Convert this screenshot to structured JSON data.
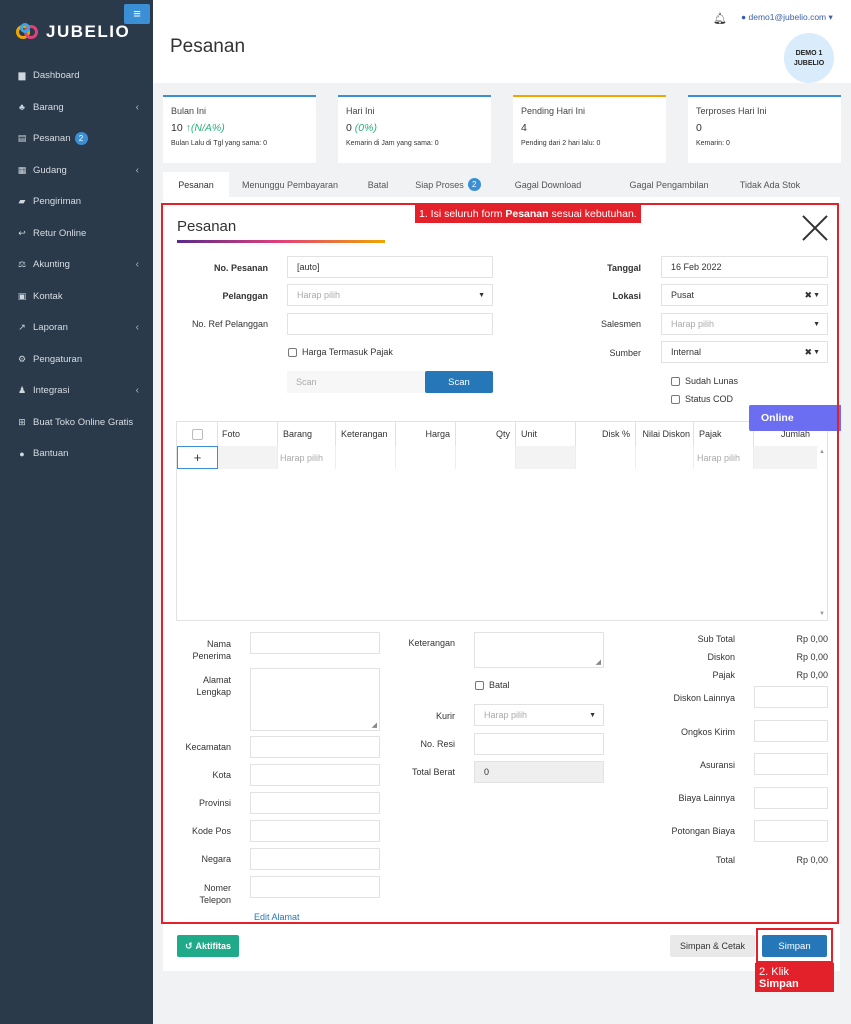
{
  "app": {
    "brand": "JUBELIO",
    "menu_toggle": "≡"
  },
  "sidebar": {
    "items": [
      {
        "label": "Dashboard",
        "icon": "▆",
        "chev": ""
      },
      {
        "label": "Barang",
        "icon": "♣",
        "chev": "‹"
      },
      {
        "label": "Pesanan",
        "icon": "▤",
        "chev": "",
        "badge": "2"
      },
      {
        "label": "Gudang",
        "icon": "▦",
        "chev": "‹"
      },
      {
        "label": "Pengiriman",
        "icon": "▰",
        "chev": ""
      },
      {
        "label": "Retur Online",
        "icon": "↩",
        "chev": ""
      },
      {
        "label": "Akunting",
        "icon": "⚖",
        "chev": "‹"
      },
      {
        "label": "Kontak",
        "icon": "▣",
        "chev": ""
      },
      {
        "label": "Laporan",
        "icon": "↗",
        "chev": "‹"
      },
      {
        "label": "Pengaturan",
        "icon": "⚙",
        "chev": ""
      },
      {
        "label": "Integrasi",
        "icon": "♟",
        "chev": "‹"
      },
      {
        "label": "Buat Toko Online Gratis",
        "icon": "⊞",
        "chev": ""
      },
      {
        "label": "Bantuan",
        "icon": "●",
        "chev": ""
      }
    ]
  },
  "header": {
    "title": "Pesanan",
    "user_email": "demo1@jubelio.com",
    "avatar_line1": "DEMO 1",
    "avatar_line2": "JUBELIO"
  },
  "stats": [
    {
      "title": "Bulan Ini",
      "value": "10",
      "delta": "(N/A%)",
      "sub": "Bulan Lalu di Tgl yang sama: 0",
      "color": "#3b8fd4"
    },
    {
      "title": "Hari Ini",
      "value": "0",
      "delta": "(0%)",
      "sub": "Kemarin di Jam yang sama: 0",
      "color": "#3b8fd4"
    },
    {
      "title": "Pending Hari Ini",
      "value": "4",
      "delta": "",
      "sub": "Pending dari 2 hari lalu: 0",
      "color": "#f0a500"
    },
    {
      "title": "Terproses Hari Ini",
      "value": "0",
      "delta": "",
      "sub": "Kemarin: 0",
      "color": "#3b8fd4"
    }
  ],
  "tabs": [
    {
      "label": "Pesanan"
    },
    {
      "label": "Menunggu Pembayaran"
    },
    {
      "label": "Batal"
    },
    {
      "label": "Siap Proses",
      "badge": "2"
    },
    {
      "label": "Gagal Download"
    },
    {
      "label": "Gagal Pengambilan"
    },
    {
      "label": "Tidak Ada Stok"
    }
  ],
  "callouts": {
    "c1_prefix": "1. Isi seluruh form ",
    "c1_bold": "Pesanan",
    "c1_suffix": " sesuai kebutuhan.",
    "c2_prefix": "2. Klik ",
    "c2_bold": "Simpan"
  },
  "form": {
    "title": "Pesanan",
    "no_pesanan_label": "No. Pesanan",
    "no_pesanan_value": "[auto]",
    "pelanggan_label": "Pelanggan",
    "pelanggan_placeholder": "Harap pilih",
    "no_ref_label": "No. Ref Pelanggan",
    "harga_pajak_label": "Harga Termasuk Pajak",
    "scan_placeholder": "Scan",
    "scan_button": "Scan",
    "tanggal_label": "Tanggal",
    "tanggal_value": "16 Feb 2022",
    "lokasi_label": "Lokasi",
    "lokasi_value": "Pusat",
    "salesmen_label": "Salesmen",
    "salesmen_placeholder": "Harap pilih",
    "sumber_label": "Sumber",
    "sumber_value": "Internal",
    "sudah_lunas_label": "Sudah Lunas",
    "status_cod_label": "Status COD",
    "online_tag": "Online"
  },
  "grid": {
    "columns": [
      "Foto",
      "Barang",
      "Keterangan",
      "Harga",
      "Qty",
      "Unit",
      "Disk %",
      "Nilai Diskon",
      "Pajak",
      "Jumlah"
    ],
    "add_symbol": "+",
    "barang_placeholder": "Harap pilih",
    "pajak_placeholder": "Harap pilih"
  },
  "shipping": {
    "nama_label": "Nama Penerima",
    "alamat_label": "Alamat Lengkap",
    "kecamatan_label": "Kecamatan",
    "kota_label": "Kota",
    "provinsi_label": "Provinsi",
    "kode_pos_label": "Kode Pos",
    "negara_label": "Negara",
    "telepon_label": "Nomer Telepon",
    "edit_alamat": "Edit Alamat",
    "keterangan_label": "Keterangan",
    "batal_label": "Batal",
    "kurir_label": "Kurir",
    "kurir_placeholder": "Harap pilih",
    "no_resi_label": "No. Resi",
    "total_berat_label": "Total Berat",
    "total_berat_value": "0"
  },
  "totals": {
    "sub_total_label": "Sub Total",
    "sub_total_value": "Rp 0,00",
    "diskon_label": "Diskon",
    "diskon_value": "Rp 0,00",
    "pajak_label": "Pajak",
    "pajak_value": "Rp 0,00",
    "diskon_lain_label": "Diskon Lainnya",
    "ongkos_label": "Ongkos Kirim",
    "asuransi_label": "Asuransi",
    "biaya_lain_label": "Biaya Lainnya",
    "potongan_label": "Potongan Biaya",
    "total_label": "Total",
    "total_value": "Rp 0,00"
  },
  "actions": {
    "aktifitas": "Aktifitas",
    "simpan_cetak": "Simpan & Cetak",
    "simpan": "Simpan"
  }
}
